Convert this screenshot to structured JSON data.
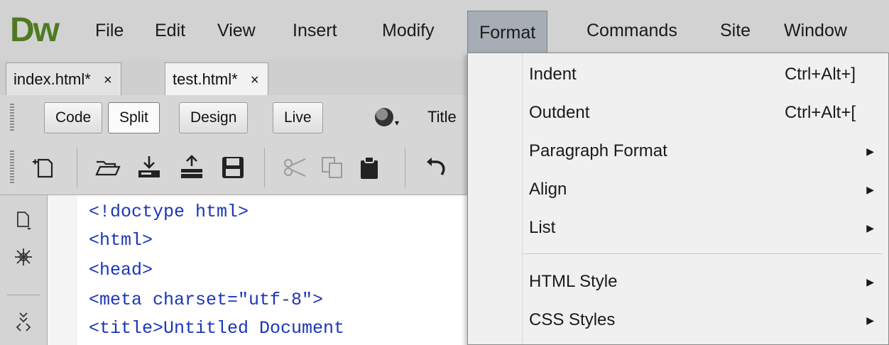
{
  "app": {
    "logo": "Dw"
  },
  "menubar": {
    "items": [
      "File",
      "Edit",
      "View",
      "Insert",
      "Modify",
      "Format",
      "Commands",
      "Site",
      "Window"
    ],
    "active": "Format"
  },
  "tabs": [
    {
      "label": "index.html*",
      "close": "×"
    },
    {
      "label": "test.html*",
      "close": "×"
    }
  ],
  "doc_toolbar": {
    "views": [
      "Code",
      "Split",
      "Design",
      "Live"
    ],
    "selected_view": "Split",
    "title_label": "Title"
  },
  "code": {
    "lines": [
      "<!doctype html>",
      "<html>",
      "<head>",
      "<meta charset=\"utf-8\">",
      "<title>Untitled Document"
    ]
  },
  "format_menu": {
    "items": [
      {
        "label": "Indent",
        "shortcut": "Ctrl+Alt+]",
        "submenu": false
      },
      {
        "label": "Outdent",
        "shortcut": "Ctrl+Alt+[",
        "submenu": false
      },
      {
        "label": "Paragraph Format",
        "shortcut": "",
        "submenu": true
      },
      {
        "label": "Align",
        "shortcut": "",
        "submenu": true
      },
      {
        "label": "List",
        "shortcut": "",
        "submenu": true
      },
      {
        "label": "HTML Style",
        "shortcut": "",
        "submenu": true
      },
      {
        "label": "CSS Styles",
        "shortcut": "",
        "submenu": true
      }
    ],
    "submenu_arrow": "▶"
  },
  "colors": {
    "logo_green": "#4f7a23",
    "code_tag_blue": "#1a36b8",
    "menu_open_bg": "#a7adb5"
  }
}
